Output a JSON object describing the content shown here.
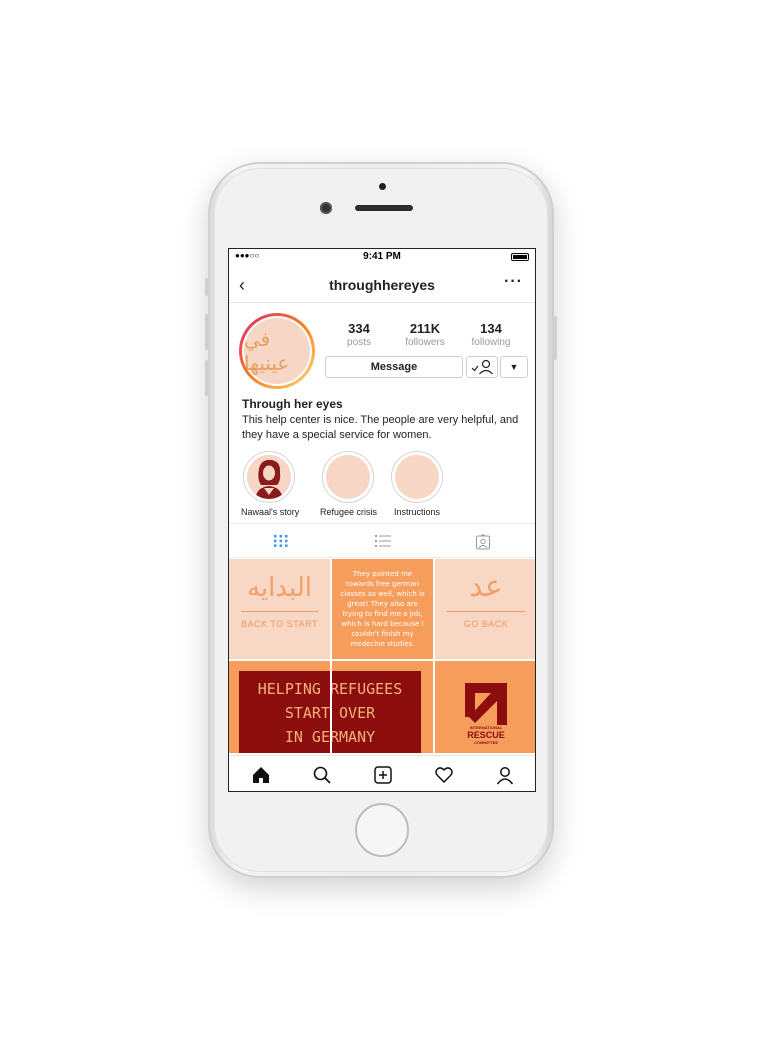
{
  "status": {
    "signal": "●●●○○",
    "time": "9:41 PM"
  },
  "header": {
    "back": "‹",
    "username": "throughhereyes",
    "more": "···"
  },
  "profile": {
    "avatar_text": "في عينيها"
  },
  "stats": [
    {
      "value": "334",
      "label": "posts"
    },
    {
      "value": "211K",
      "label": "followers"
    },
    {
      "value": "134",
      "label": "following"
    }
  ],
  "actions": {
    "message": "Message",
    "dropdown": "▼"
  },
  "bio": {
    "name": "Through her eyes",
    "text": "This help center is nice. The people are very helpful, and they have a special service for women."
  },
  "highlights": [
    {
      "label": "Nawaal's story"
    },
    {
      "label": "Refugee crisis"
    },
    {
      "label": "Instructions"
    }
  ],
  "grid": {
    "cell1": {
      "arabic": "البدايه",
      "label": "BACK TO START"
    },
    "cell2": {
      "quote": "They pointed me towards free german classes as well, which is great! They also are trying to find me a job, which is hard because I couldn't finish my medecine studies."
    },
    "cell3": {
      "arabic": "عد",
      "label": "GO BACK"
    },
    "banner": {
      "line1": "HELPING REFUGEES",
      "line2": "START OVER",
      "line3": "IN GERMANY"
    },
    "logo": {
      "l1": "INTERNATIONAL",
      "l2": "RESCUE",
      "l3": "COMMITTEE"
    }
  },
  "colors": {
    "peach": "#f8d7c4",
    "orange": "#f79d5c",
    "maroon": "#8b0d0d",
    "accent_blue": "#3897f0"
  },
  "icons": [
    "home-icon",
    "search-icon",
    "add-post-icon",
    "heart-icon",
    "profile-icon",
    "grid-icon",
    "list-icon",
    "tagged-icon"
  ]
}
